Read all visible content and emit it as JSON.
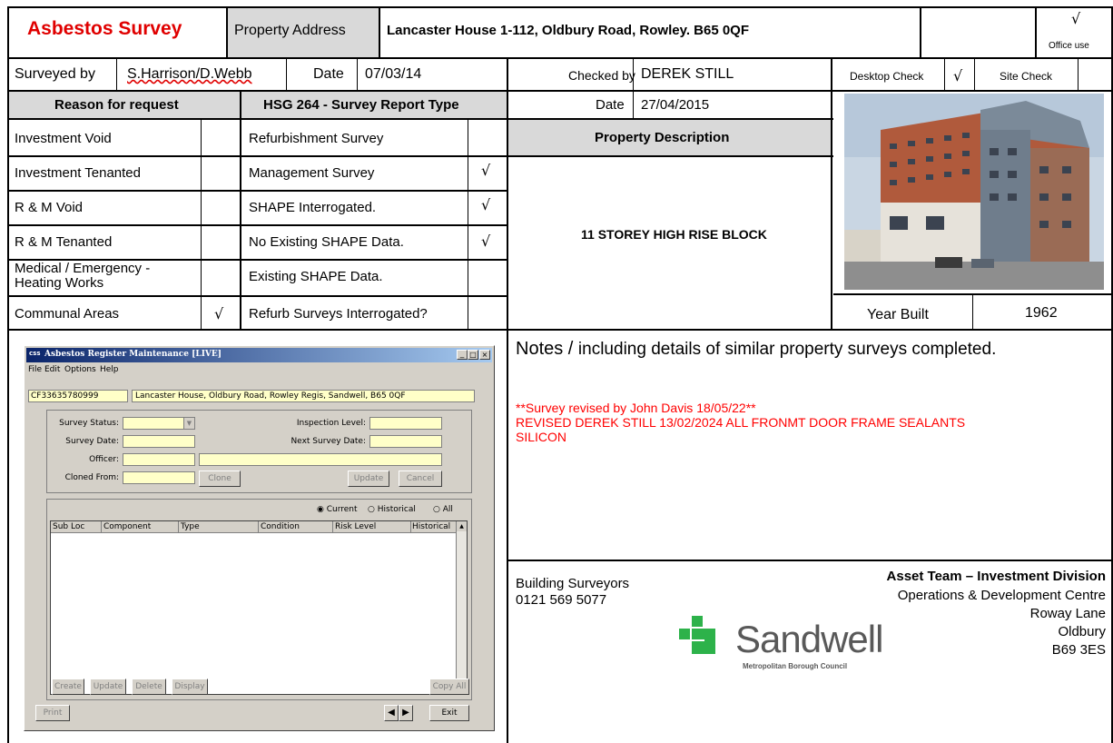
{
  "header": {
    "title": "Asbestos Survey",
    "property_address_label": "Property Address",
    "property_address": "Lancaster House 1-112, Oldbury Road, Rowley.  B65 0QF",
    "office_use_tick": "√",
    "office_use_label": "Office use"
  },
  "survey_row": {
    "surveyed_by_label": "Surveyed by",
    "surveyed_by": "S.Harrison/D.Webb",
    "date_label": "Date",
    "date": "07/03/14",
    "checked_by_label": "Checked by",
    "checked_by": "DEREK STILL",
    "desktop_check_label": "Desktop Check",
    "desktop_check_tick": "√",
    "site_check_label": "Site Check"
  },
  "reason": {
    "header": "Reason for request",
    "items": [
      {
        "label": "Investment Void",
        "tick": ""
      },
      {
        "label": "Investment Tenanted",
        "tick": ""
      },
      {
        "label": "R & M Void",
        "tick": ""
      },
      {
        "label": "R & M Tenanted",
        "tick": ""
      },
      {
        "label": "Medical / Emergency -",
        "label2": "Heating Works",
        "tick": ""
      },
      {
        "label": "Communal Areas",
        "tick": "√"
      }
    ]
  },
  "report_type": {
    "header": "HSG 264 - Survey Report Type",
    "items": [
      {
        "label": "Refurbishment Survey",
        "tick": ""
      },
      {
        "label": "Management Survey",
        "tick": "√"
      },
      {
        "label": "SHAPE Interrogated.",
        "tick": "√"
      },
      {
        "label": "No Existing SHAPE Data.",
        "tick": "√"
      },
      {
        "label": "Existing SHAPE Data.",
        "tick": ""
      },
      {
        "label": "Refurb Surveys Interrogated?",
        "tick": ""
      }
    ]
  },
  "check_date": {
    "label": "Date",
    "value": "27/04/2015"
  },
  "property": {
    "description_label": "Property Description",
    "description": "11 STOREY HIGH RISE BLOCK",
    "year_built_label": "Year Built",
    "year_built": "1962"
  },
  "notes": {
    "heading_a": "Notes / ",
    "heading_b": "including details of similar property surveys completed.",
    "line1": "**Survey revised by John Davis 18/05/22**",
    "line2": "REVISED DEREK STILL 13/02/2024 ALL FRONMT DOOR FRAME SEALANTS",
    "line3": "SILICON"
  },
  "contact": {
    "dept": "Building Surveyors",
    "phone": "0121 569 5077",
    "team": "Asset Team – Investment Division",
    "addr1": "Operations & Development Centre",
    "addr2": "Roway Lane",
    "addr3": "Oldbury",
    "addr4": "B69 3ES",
    "logo_name": "Sandwell",
    "logo_sub": "Metropolitan Borough Council"
  },
  "app_window": {
    "title": "Asbestos Register Maintenance [LIVE]",
    "title_prefix": "css",
    "menu": [
      "File",
      "Edit",
      "Options",
      "Help"
    ],
    "ref": "CF33635780999",
    "address": "Lancaster House, Oldbury Road, Rowley Regis, Sandwell, B65 0QF",
    "survey_status_label": "Survey Status:",
    "survey_date_label": "Survey Date:",
    "officer_label": "Officer:",
    "cloned_from_label": "Cloned From:",
    "inspection_level_label": "Inspection Level:",
    "next_survey_date_label": "Next Survey Date:",
    "clone_btn": "Clone",
    "update_btn": "Update",
    "cancel_btn": "Cancel",
    "radio_current": "Current",
    "radio_historical": "Historical",
    "radio_all": "All",
    "columns": [
      "Sub Loc",
      "Component",
      "Type",
      "Condition",
      "Risk Level",
      "Historical"
    ],
    "btn_create": "Create",
    "btn_update": "Update",
    "btn_delete": "Delete",
    "btn_display": "Display",
    "btn_copy_all": "Copy All",
    "btn_print": "Print",
    "btn_exit": "Exit"
  },
  "colors": {
    "title_red": "#e00000",
    "notes_red": "#ff0000",
    "grey_header": "#d9d9d9",
    "field_yellow": "#ffffc8",
    "logo_green": "#2db24a"
  }
}
